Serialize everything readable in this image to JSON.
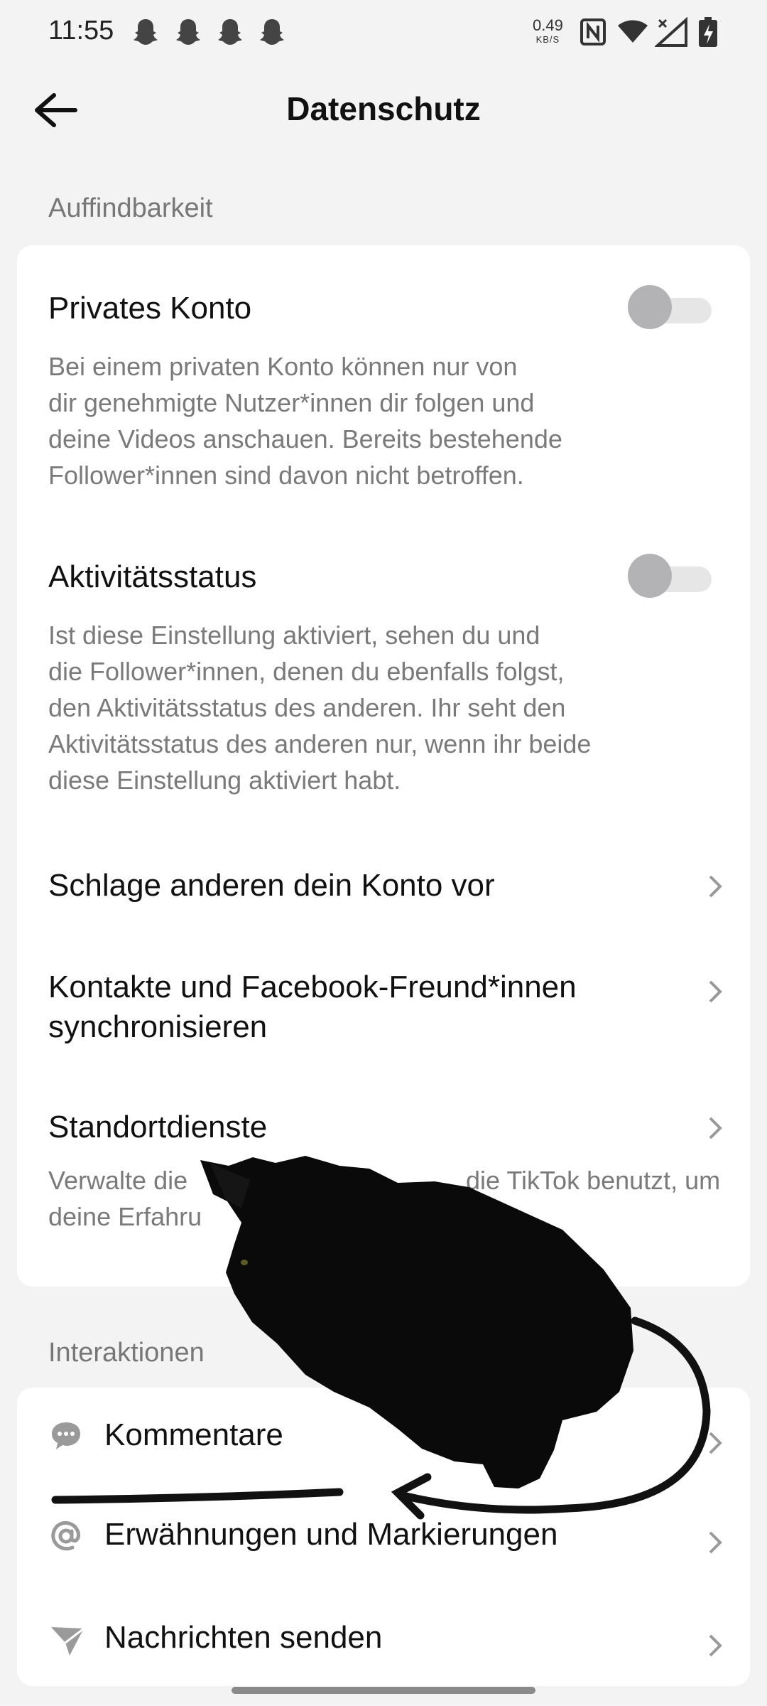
{
  "status_bar": {
    "time": "11:55",
    "net_speed": "0.49",
    "net_unit": "KB/S",
    "icons": [
      "snapchat-ghost-icon",
      "snapchat-ghost-icon",
      "snapchat-ghost-icon",
      "snapchat-ghost-icon",
      "nfc-icon",
      "wifi-icon",
      "cell-signal-icon",
      "battery-charging-icon"
    ]
  },
  "header": {
    "title": "Datenschutz",
    "back_icon": "arrow-left-icon"
  },
  "sections": {
    "discoverability": {
      "label": "Auffindbarkeit",
      "private_account": {
        "title": "Privates Konto",
        "desc_lines": [
          "Bei einem privaten Konto können nur von",
          "dir genehmigte Nutzer*innen dir folgen und",
          "deine Videos anschauen. Bereits bestehende",
          "Follower*innen sind davon nicht betroffen."
        ],
        "enabled": false
      },
      "activity_status": {
        "title": "Aktivitätsstatus",
        "desc_lines": [
          "Ist diese Einstellung aktiviert, sehen du und",
          "die Follower*innen, denen du ebenfalls folgst,",
          "den Aktivitätsstatus des anderen. Ihr seht den",
          "Aktivitätsstatus des anderen nur, wenn ihr beide",
          "diese Einstellung aktiviert habt."
        ],
        "enabled": false
      },
      "suggest_account": {
        "title": "Schlage anderen dein Konto vor"
      },
      "sync_contacts": {
        "title_lines": [
          "Kontakte und Facebook-Freund*innen",
          "synchronisieren"
        ]
      },
      "location": {
        "title": "Standortdienste",
        "desc_lines": [
          "Verwalte die",
          "die TikTok benutzt, um",
          "deine Erfahru"
        ]
      }
    },
    "interactions": {
      "label": "Interaktionen",
      "items": [
        {
          "label": "Kommentare",
          "icon": "comment-bubble-icon"
        },
        {
          "label": "Erwähnungen und Markierungen",
          "icon": "at-sign-icon"
        },
        {
          "label": "Nachrichten senden",
          "icon": "send-paper-plane-icon"
        }
      ]
    }
  },
  "colors": {
    "background": "#f3f3f3",
    "card": "#ffffff",
    "muted_text": "#7a7a7a",
    "toggle_off_knob": "#b3b3b6",
    "annotation": "#111111"
  },
  "overlay": {
    "sticker": "black-cat-sticker",
    "annotation": "hand-drawn-arrow-and-underline"
  }
}
